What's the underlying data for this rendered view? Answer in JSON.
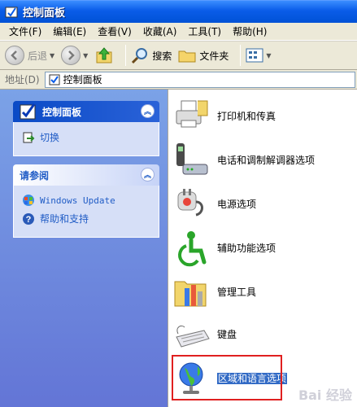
{
  "window": {
    "title": "控制面板"
  },
  "menu": [
    "文件(F)",
    "编辑(E)",
    "查看(V)",
    "收藏(A)",
    "工具(T)",
    "帮助(H)"
  ],
  "toolbar": {
    "back": "后退",
    "search": "搜索",
    "folders": "文件夹"
  },
  "address": {
    "label": "地址(D)",
    "value": "控制面板"
  },
  "left_pane": {
    "control_panel": {
      "title": "控制面板",
      "switch_link": "切换"
    },
    "see_also": {
      "title": "请参阅",
      "links": [
        "Windows Update",
        "帮助和支持"
      ]
    }
  },
  "items": [
    {
      "label": "打印机和传真",
      "icon": "printer-icon"
    },
    {
      "label": "电话和调制解调器选项",
      "icon": "phone-modem-icon"
    },
    {
      "label": "电源选项",
      "icon": "power-plug-icon"
    },
    {
      "label": "辅助功能选项",
      "icon": "accessibility-icon"
    },
    {
      "label": "管理工具",
      "icon": "admin-tools-icon"
    },
    {
      "label": "键盘",
      "icon": "keyboard-icon"
    },
    {
      "label": "区域和语言选项",
      "icon": "globe-icon",
      "selected": true
    }
  ],
  "watermark": "Bai 经验"
}
